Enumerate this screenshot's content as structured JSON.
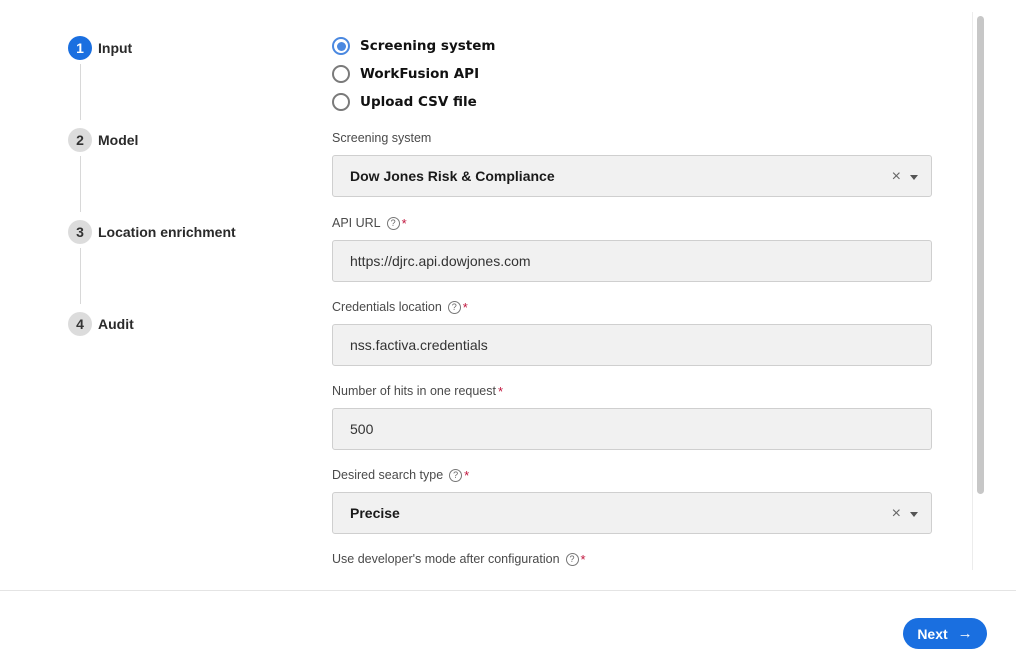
{
  "stepper": {
    "steps": [
      {
        "num": "1",
        "label": "Input"
      },
      {
        "num": "2",
        "label": "Model"
      },
      {
        "num": "3",
        "label": "Location enrichment"
      },
      {
        "num": "4",
        "label": "Audit"
      }
    ],
    "active_index": 0
  },
  "source": {
    "options": [
      "Screening system",
      "WorkFusion API",
      "Upload CSV file"
    ],
    "selected": "Screening system"
  },
  "fields": {
    "screening_system": {
      "label": "Screening system",
      "value": "Dow Jones Risk & Compliance"
    },
    "api_url": {
      "label": "API URL",
      "required": "*",
      "value": "https://djrc.api.dowjones.com"
    },
    "credentials": {
      "label": "Credentials location",
      "required": "*",
      "value": "nss.factiva.credentials"
    },
    "hits": {
      "label": "Number of hits in one request",
      "required": "*",
      "value": "500"
    },
    "search_type": {
      "label": "Desired search type",
      "required": "*",
      "value": "Precise"
    },
    "dev_mode": {
      "label": "Use developer's mode after configuration",
      "required": "*"
    }
  },
  "icons": {
    "help": "?",
    "clear": "×",
    "arrow": "→"
  },
  "footer": {
    "next_label": "Next"
  },
  "colors": {
    "primary": "#1a6fe0",
    "required": "#c0143c"
  }
}
